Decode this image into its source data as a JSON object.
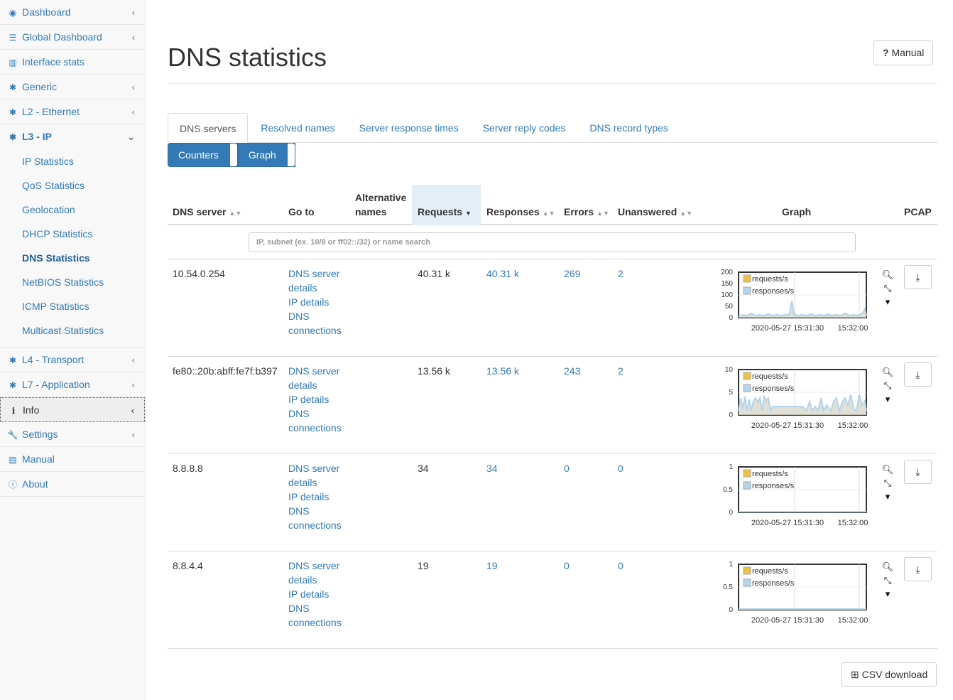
{
  "sidebar": {
    "items": [
      {
        "label": "Dashboard",
        "icon": "dashboard-icon"
      },
      {
        "label": "Global Dashboard",
        "icon": "dashboard-list-icon"
      },
      {
        "label": "Interface stats",
        "icon": "bar-chart-icon"
      },
      {
        "label": "Generic",
        "icon": "gear-icon"
      },
      {
        "label": "L2 - Ethernet",
        "icon": "gear-icon"
      },
      {
        "label": "L3 - IP",
        "icon": "gear-icon"
      },
      {
        "label": "L4 - Transport",
        "icon": "gear-icon"
      },
      {
        "label": "L7 - Application",
        "icon": "gear-icon"
      },
      {
        "label": "Info",
        "icon": "info-icon"
      },
      {
        "label": "Settings",
        "icon": "wrench-icon"
      },
      {
        "label": "Manual",
        "icon": "book-icon"
      },
      {
        "label": "About",
        "icon": "info-circle-icon"
      }
    ],
    "l3_subitems": [
      "IP Statistics",
      "QoS Statistics",
      "Geolocation",
      "DHCP Statistics",
      "DNS Statistics",
      "NetBIOS Statistics",
      "ICMP Statistics",
      "Multicast Statistics"
    ]
  },
  "page": {
    "title": "DNS statistics",
    "manual_button": "Manual",
    "manual_glyph": "?"
  },
  "tabs": [
    "DNS servers",
    "Resolved names",
    "Server response times",
    "Server reply codes",
    "DNS record types"
  ],
  "view_buttons": [
    "Counters",
    "Graph"
  ],
  "table": {
    "headers": {
      "server": "DNS server",
      "goto": "Go to",
      "alt_line1": "Alternative",
      "alt_line2": "names",
      "requests": "Requests",
      "responses": "Responses",
      "errors": "Errors",
      "unanswered": "Unanswered",
      "graph": "Graph",
      "pcap": "PCAP"
    },
    "filter_placeholder": "IP, subnet (ex. 10/8 or ff02::/32) or name search",
    "goto_links": [
      "DNS server",
      "details",
      "IP details",
      "DNS",
      "connections"
    ],
    "legend": [
      "requests/s",
      "responses/s"
    ],
    "time_labels": [
      "2020-05-27 15:31:30",
      "15:32:00"
    ],
    "rows": [
      {
        "server": "10.54.0.254",
        "requests": "40.31 k",
        "responses": "40.31 k",
        "errors": "269",
        "unanswered": "2",
        "y_ticks": [
          "200",
          "150",
          "100",
          "50",
          "0"
        ]
      },
      {
        "server": "fe80::20b:abff:fe7f:b397",
        "requests": "13.56 k",
        "responses": "13.56 k",
        "errors": "243",
        "unanswered": "2",
        "y_ticks": [
          "10",
          "5",
          "0"
        ]
      },
      {
        "server": "8.8.8.8",
        "requests": "34",
        "responses": "34",
        "errors": "0",
        "unanswered": "0",
        "y_ticks": [
          "1",
          "0.5",
          "0"
        ]
      },
      {
        "server": "8.8.4.4",
        "requests": "19",
        "responses": "19",
        "errors": "0",
        "unanswered": "0",
        "y_ticks": [
          "1",
          "0.5",
          "0"
        ]
      }
    ]
  },
  "csv_button": "CSV download",
  "colors": {
    "link": "#337ab7",
    "requests": "#f0c040",
    "responses": "#b3d4ea"
  }
}
